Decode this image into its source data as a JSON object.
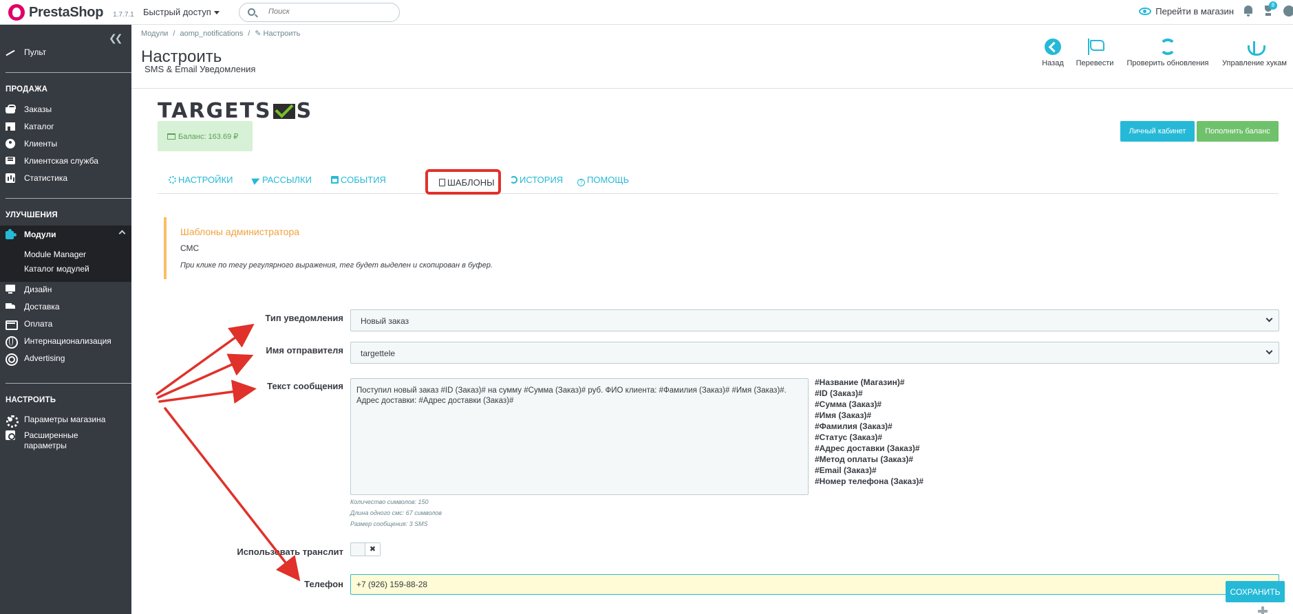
{
  "header": {
    "logo_text": "PrestaShop",
    "version": "1.7.7.1",
    "quick_access_label": "Быстрый доступ",
    "search_placeholder": "Поиск",
    "view_shop_label": "Перейти в магазин",
    "notifications_badge": "8"
  },
  "sidebar": {
    "dashboard": "Пульт",
    "section_sell": "ПРОДАЖА",
    "sell_items": [
      "Заказы",
      "Каталог",
      "Клиенты",
      "Клиентская служба",
      "Статистика"
    ],
    "section_improve": "УЛУЧШЕНИЯ",
    "modules": "Модули",
    "modules_sub": [
      "Module Manager",
      "Каталог модулей"
    ],
    "improve_items": [
      "Дизайн",
      "Доставка",
      "Оплата",
      "Интернационализация",
      "Advertising"
    ],
    "section_configure": "НАСТРОИТЬ",
    "shop_params": "Параметры магазина",
    "advanced_params_line1": "Расширенные",
    "advanced_params_line2": "параметры"
  },
  "page_header": {
    "breadcrumb": [
      "Модули",
      "aomp_notifications",
      "Настроить"
    ],
    "title": "Настроить",
    "subtitle": "SMS & Email Уведомления",
    "toolbar": [
      "Назад",
      "Перевести",
      "Проверить обновления",
      "Управление хукам"
    ]
  },
  "module": {
    "brand_part1": "TARGETS",
    "brand_part2": "S",
    "balance": "Баланс: 163.69 ₽",
    "cabinet_button": "Личный кабинет",
    "topup_button": "Пополнить баланс",
    "tabs": [
      "НАСТРОЙКИ",
      "РАССЫЛКИ",
      "СОБЫТИЯ",
      "ШАБЛОНЫ",
      "ИСТОРИЯ",
      "ПОМОЩЬ"
    ],
    "active_tab": "ШАБЛОНЫ"
  },
  "alert": {
    "title": "Шаблоны администратора",
    "subtitle": "СМС",
    "hint": "При клике по тегу регулярного выражения, тег будет выделен и скопирован в буфер."
  },
  "form": {
    "notification_type_label": "Тип уведомления",
    "notification_type_value": "Новый заказ",
    "sender_label": "Имя отправителя",
    "sender_value": "targettele",
    "message_label": "Текст сообщения",
    "message_value": "Поступил новый заказ #ID (Заказ)# на сумму #Сумма (Заказ)# руб. ФИО клиента: #Фамилия (Заказ)# #Имя (Заказ)#. Адрес доставки: #Адрес доставки (Заказ)#",
    "tags": [
      "#Название (Магазин)#",
      "#ID (Заказ)#",
      "#Сумма (Заказ)#",
      "#Имя (Заказ)#",
      "#Фамилия (Заказ)#",
      "#Статус (Заказ)#",
      "#Адрес доставки (Заказ)#",
      "#Метод оплаты (Заказ)#",
      "#Email (Заказ)#",
      "#Номер телефона (Заказ)#"
    ],
    "char_count": "Количество символов: 150",
    "sms_length": "Длина одного смс: 67 символов",
    "message_size": "Размер сообщения: 3 SMS",
    "translit_label": "Использовать транслит",
    "translit_state": "✖",
    "phone_label": "Телефон",
    "phone_value": "+7 (926) 159-88-28",
    "save_button": "СОХРАНИТЬ"
  },
  "colors": {
    "accent": "#25b9d7",
    "sidebar_bg": "#363a41",
    "annotation_red": "#e0312a",
    "warning": "#fcbc66",
    "success": "#70c16c"
  }
}
